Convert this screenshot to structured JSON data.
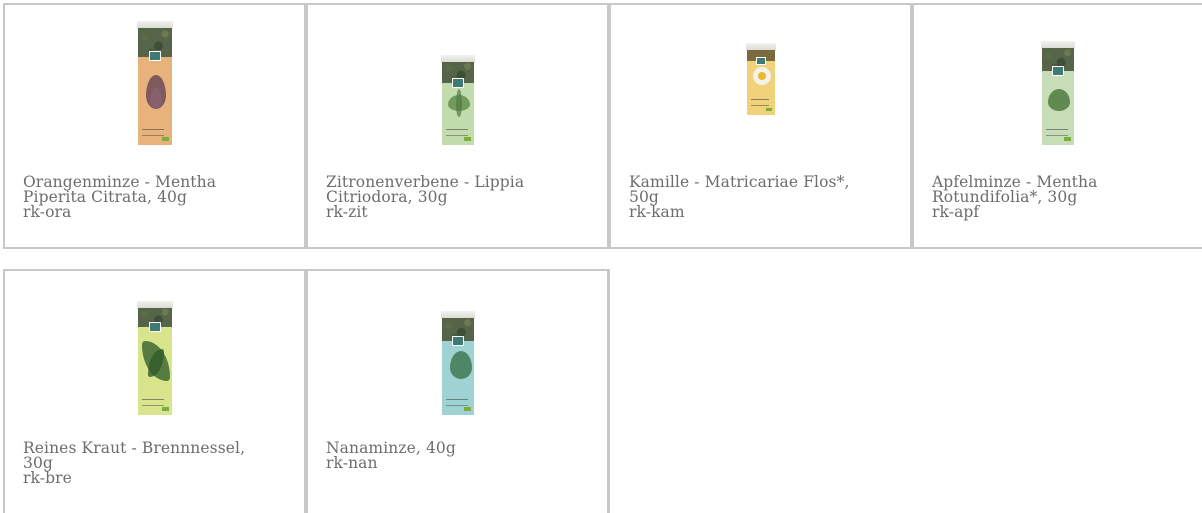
{
  "products": [
    {
      "name": "Orangenminze - Mentha Piperita Citrata, 40g",
      "sku": "rk-ora",
      "image_icon": "tea-bag-orangenminze-image",
      "label_color": "#e8b27c",
      "leaf_color": "#6b4a5a"
    },
    {
      "name": "Zitronenverbene - Lippia Citriodora, 30g",
      "sku": "rk-zit",
      "image_icon": "tea-bag-zitronenverbene-image",
      "label_color": "#c3dcae",
      "leaf_color": "#5f8a4a"
    },
    {
      "name": "Kamille - Matricariae Flos*, 50g",
      "sku": "rk-kam",
      "image_icon": "tea-bag-kamille-image",
      "label_color": "#efd27a",
      "leaf_color": "#f3f1e8"
    },
    {
      "name": "Apfelminze - Mentha Rotundifolia*, 30g",
      "sku": "rk-apf",
      "image_icon": "tea-bag-apfelminze-image",
      "label_color": "#c7ddb8",
      "leaf_color": "#4f7a3e"
    },
    {
      "name": "Reines Kraut - Brennnessel, 30g",
      "sku": "rk-bre",
      "image_icon": "tea-bag-brennnessel-image",
      "label_color": "#d9e58c",
      "leaf_color": "#3f6a34"
    },
    {
      "name": "Nanaminze, 40g",
      "sku": "rk-nan",
      "image_icon": "tea-bag-nanaminze-image",
      "label_color": "#9fd2d2",
      "leaf_color": "#3e7a52"
    }
  ]
}
